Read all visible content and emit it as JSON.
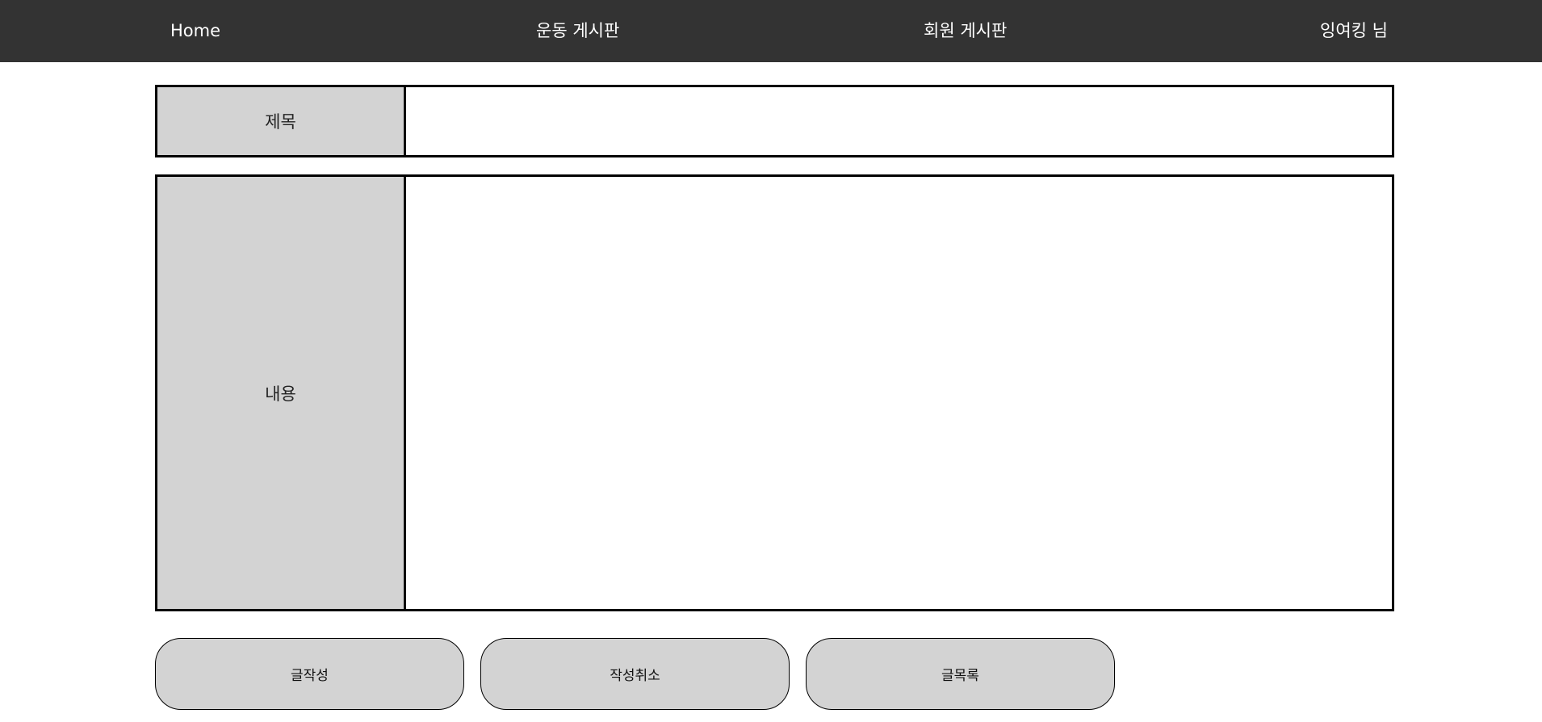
{
  "nav": {
    "home": "Home",
    "exercise_board": "운동 게시판",
    "member_board": "회원 게시판",
    "user_greeting": "잉여킹 님"
  },
  "form": {
    "title_label": "제목",
    "title_value": "",
    "content_label": "내용",
    "content_value": ""
  },
  "buttons": {
    "write": "글작성",
    "cancel": "작성취소",
    "list": "글목록"
  },
  "colors": {
    "nav_background": "#333333",
    "label_background": "#d3d3d3",
    "button_background": "#d3d3d3"
  }
}
